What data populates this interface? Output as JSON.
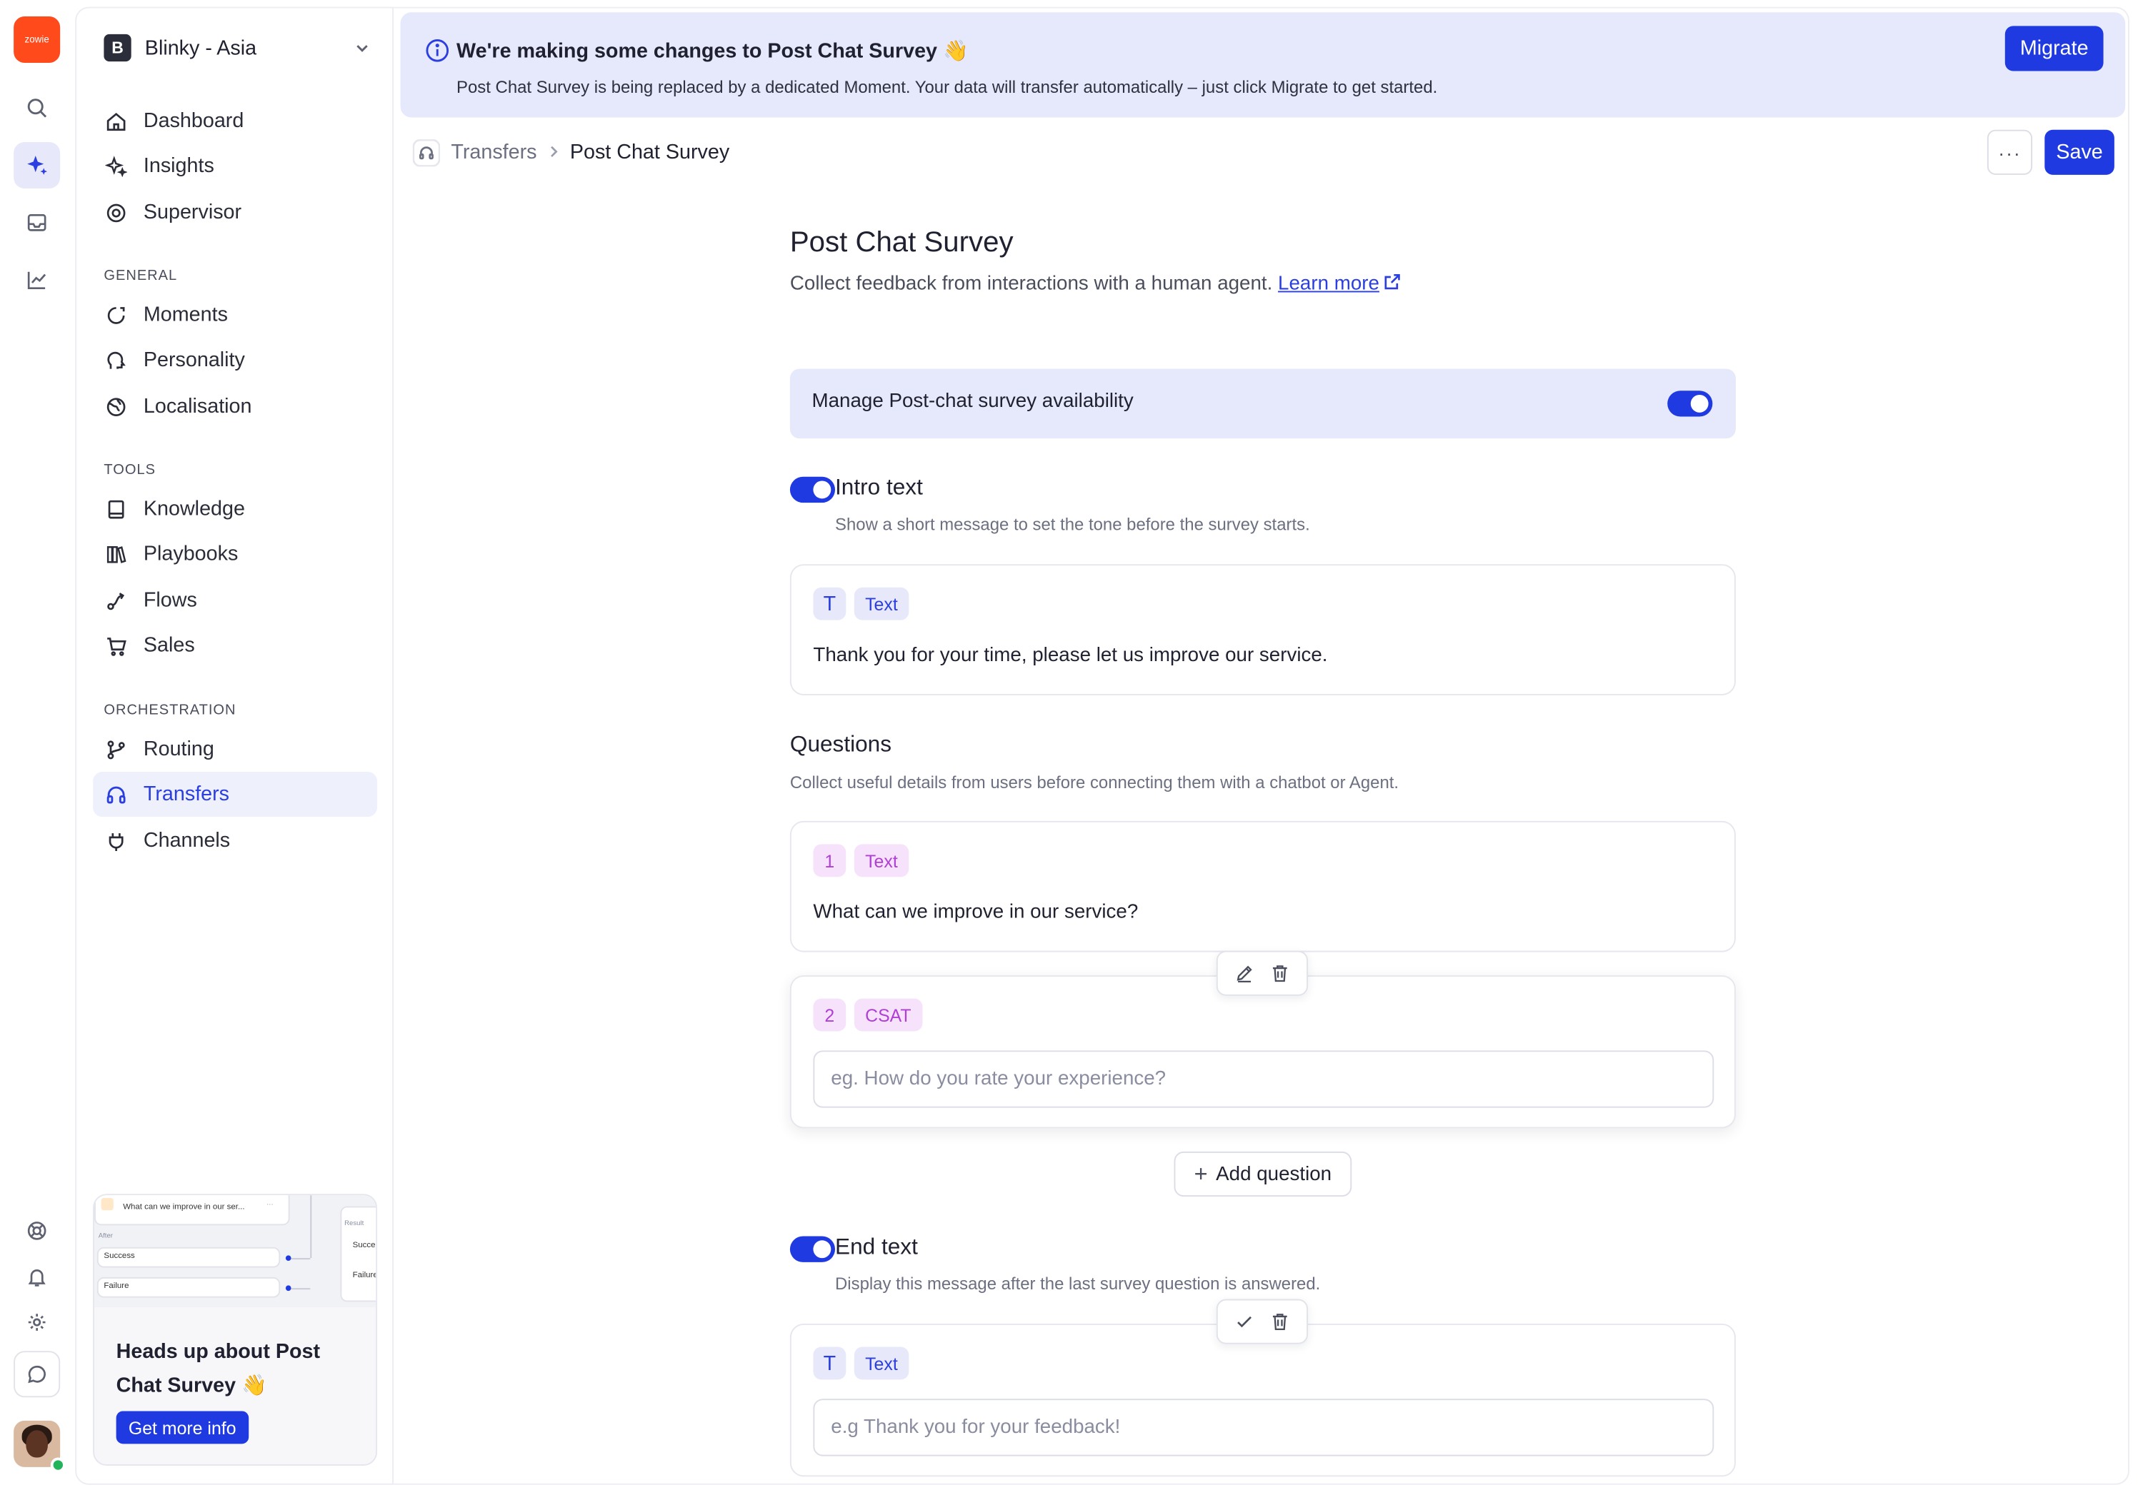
{
  "rail": {
    "logo_text": "zowie",
    "icons": [
      "search-icon",
      "sparkles-icon",
      "inbox-icon",
      "analytics-icon",
      "help-icon",
      "bell-icon",
      "settings-icon",
      "chat-icon"
    ]
  },
  "workspace": {
    "initial": "B",
    "name": "Blinky - Asia"
  },
  "nav": {
    "top": [
      {
        "label": "Dashboard",
        "icon": "home-icon"
      },
      {
        "label": "Insights",
        "icon": "sparkles-icon"
      },
      {
        "label": "Supervisor",
        "icon": "at-icon"
      }
    ],
    "general_label": "GENERAL",
    "general": [
      {
        "label": "Moments",
        "icon": "moments-icon"
      },
      {
        "label": "Personality",
        "icon": "personality-icon"
      },
      {
        "label": "Localisation",
        "icon": "globe-icon"
      }
    ],
    "tools_label": "TOOLS",
    "tools": [
      {
        "label": "Knowledge",
        "icon": "book-icon"
      },
      {
        "label": "Playbooks",
        "icon": "playbooks-icon"
      },
      {
        "label": "Flows",
        "icon": "flows-icon"
      },
      {
        "label": "Sales",
        "icon": "cart-icon"
      }
    ],
    "orchestration_label": "ORCHESTRATION",
    "orchestration": [
      {
        "label": "Routing",
        "icon": "routing-icon"
      },
      {
        "label": "Transfers",
        "icon": "headset-icon",
        "active": true
      },
      {
        "label": "Channels",
        "icon": "plug-icon"
      }
    ]
  },
  "promo": {
    "preview_question": "What can we improve in our ser...",
    "preview_after": "After",
    "preview_success": "Success",
    "preview_failure": "Failure",
    "preview_result": "Result",
    "preview_succe": "Succe",
    "preview_failu": "Failure",
    "title": "Heads up about Post Chat Survey 👋",
    "button": "Get more info"
  },
  "banner": {
    "title": "We're making some changes to Post Chat Survey 👋",
    "subtitle": "Post Chat Survey is being replaced by a dedicated Moment. Your data will transfer automatically – just click Migrate to get started.",
    "button": "Migrate"
  },
  "breadcrumb": {
    "parent": "Transfers",
    "current": "Post Chat Survey"
  },
  "toolbar": {
    "more": "···",
    "save": "Save"
  },
  "page": {
    "title": "Post Chat Survey",
    "subtitle": "Collect feedback from interactions with a human agent.",
    "learn_more": "Learn more"
  },
  "availability": {
    "label": "Manage Post-chat survey availability",
    "enabled": true
  },
  "intro": {
    "title": "Intro text",
    "subtitle": "Show a short message to set the tone before the survey starts.",
    "enabled": true,
    "badge_icon": "T",
    "tag": "Text",
    "text": "Thank you for your time, please let us improve our service."
  },
  "questions": {
    "title": "Questions",
    "subtitle": "Collect useful details from users before connecting them with a chatbot or Agent.",
    "items": [
      {
        "number": "1",
        "type": "Text",
        "text": "What can we improve in our service?"
      },
      {
        "number": "2",
        "type": "CSAT",
        "placeholder": "eg. How do you rate your experience?"
      }
    ],
    "add_label": "Add question"
  },
  "end": {
    "title": "End text",
    "subtitle": "Display this message after the last survey question is answered.",
    "enabled": true,
    "badge_icon": "T",
    "tag": "Text",
    "placeholder": "e.g Thank you for your feedback!"
  },
  "colors": {
    "accent": "#1f3ae0",
    "banner_bg": "#e6e8fb",
    "tag_purple": "#b03fd5",
    "logo": "#ff4a1c",
    "online": "#21b45a"
  }
}
